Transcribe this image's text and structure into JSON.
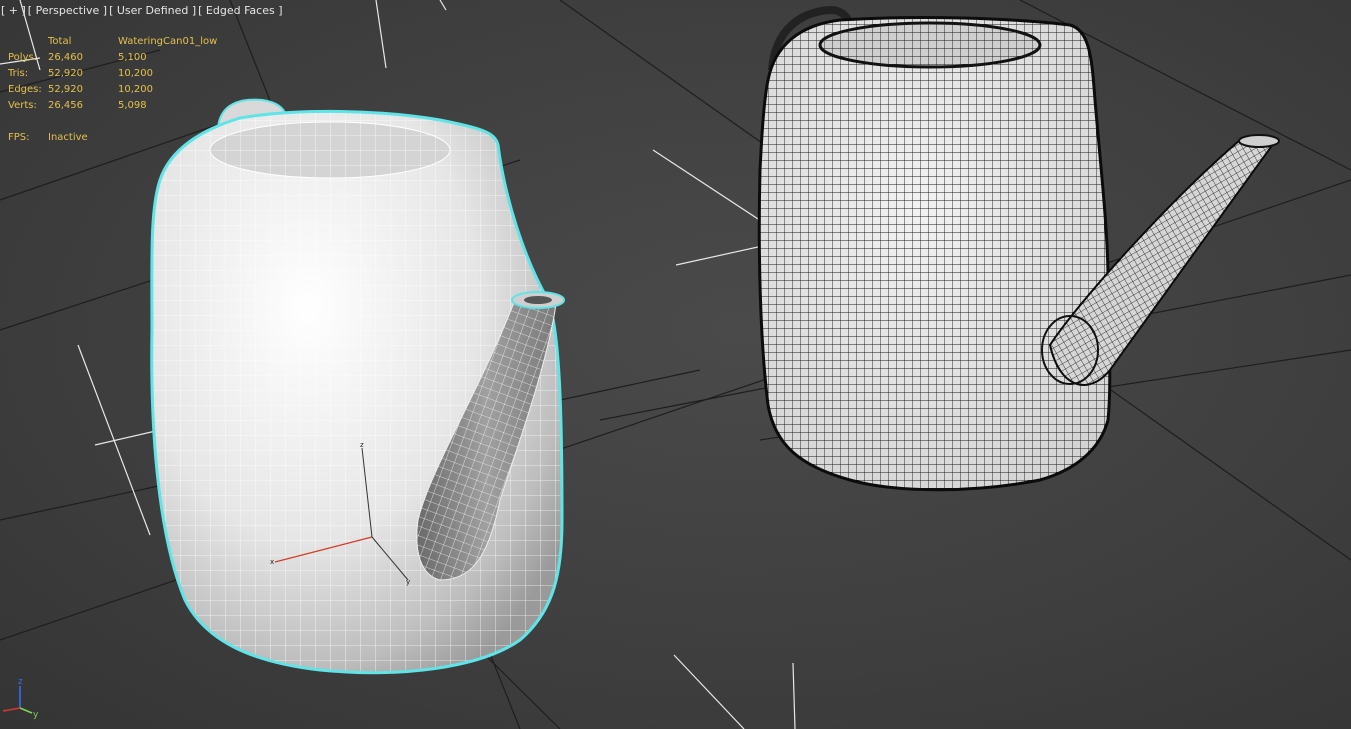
{
  "viewport": {
    "label": {
      "plus": "[ + ]",
      "view": "[ Perspective ]",
      "camera": "[ User Defined ]",
      "shading": "[ Edged Faces ]"
    },
    "stats": {
      "header": {
        "total": "Total",
        "object": "WateringCan01_low"
      },
      "rows": [
        {
          "label": "Polys:",
          "total": "26,460",
          "object": "5,100"
        },
        {
          "label": "Tris:",
          "total": "52,920",
          "object": "10,200"
        },
        {
          "label": "Edges:",
          "total": "52,920",
          "object": "10,200"
        },
        {
          "label": "Verts:",
          "total": "26,456",
          "object": "5,098"
        }
      ],
      "fps": {
        "label": "FPS:",
        "value": "Inactive"
      }
    },
    "gizmo": {
      "x": "x",
      "y": "y",
      "z": "z"
    },
    "colors": {
      "background": "#444444",
      "stats_text": "#e3c04c",
      "selection_outline": "#5fe4e8",
      "axis_x": "#d63a2a",
      "axis_y": "#7fd35a",
      "axis_z": "#3a6cf0"
    }
  }
}
